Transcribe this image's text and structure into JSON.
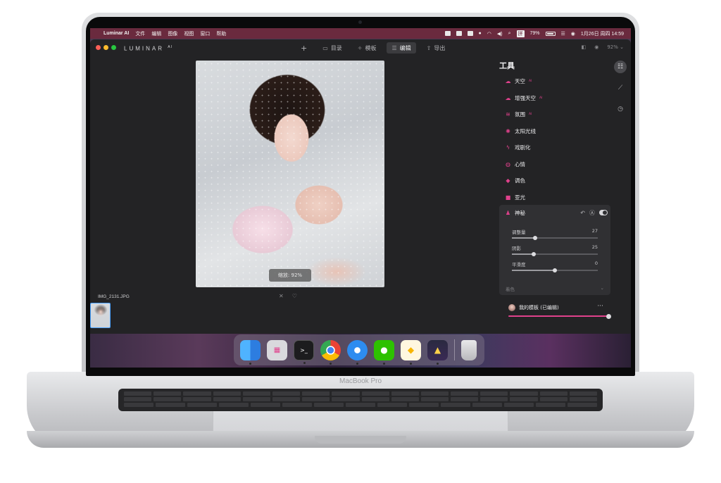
{
  "device": {
    "brand_label": "MacBook Pro"
  },
  "menubar": {
    "apple": "",
    "app_name": "Luminar AI",
    "menus": [
      "文件",
      "编辑",
      "图像",
      "视图",
      "窗口",
      "帮助"
    ],
    "input_method": "拼",
    "battery": "79%",
    "datetime": "1月26日 周四  14:59"
  },
  "app": {
    "logo": "LUMINAR",
    "logo_suffix": "AI",
    "tabs": [
      {
        "label": "目录",
        "icon": "folder-icon",
        "active": false
      },
      {
        "label": "模板",
        "icon": "sparkle-icon",
        "active": false
      },
      {
        "label": "编辑",
        "icon": "sliders-icon",
        "active": true
      },
      {
        "label": "导出",
        "icon": "share-icon",
        "active": false
      }
    ],
    "zoom": "92%"
  },
  "canvas": {
    "zoom_label": "缩放: 92%",
    "filename": "IMG_2131.JPG"
  },
  "panel": {
    "title": "工具",
    "tools": [
      {
        "label": "天空",
        "ai": "AI",
        "icon": "cloud-icon"
      },
      {
        "label": "增强天空",
        "ai": "AI",
        "icon": "cloud-plus-icon"
      },
      {
        "label": "氛围",
        "ai": "AI",
        "icon": "waves-icon"
      },
      {
        "label": "太阳光线",
        "ai": "",
        "icon": "sun-icon"
      },
      {
        "label": "戏剧化",
        "ai": "",
        "icon": "bolt-icon"
      },
      {
        "label": "心情",
        "ai": "",
        "icon": "mood-icon"
      },
      {
        "label": "调色",
        "ai": "",
        "icon": "bucket-icon"
      },
      {
        "label": "亚光",
        "ai": "",
        "icon": "square-icon"
      }
    ],
    "expanded_tool": {
      "label": "神秘",
      "sliders": [
        {
          "label": "调整量",
          "value": "27",
          "level": 0.27
        },
        {
          "label": "阴影",
          "value": "25",
          "level": 0.25
        },
        {
          "label": "平滑度",
          "value": "0",
          "level": 0.5
        }
      ]
    },
    "collapsed_section": "着色",
    "template": {
      "label": "我的模板 (已编辑)",
      "more": "···",
      "level": 1.0
    }
  },
  "dock": [
    "Finder",
    "Launchpad",
    "Terminal",
    "Chrome",
    "Safari",
    "WeChat",
    "Sketch",
    "Luminar AI",
    "Trash"
  ],
  "colors": {
    "accent": "#e0418c",
    "menubar": "#6a2a3e",
    "window": "#232325"
  }
}
